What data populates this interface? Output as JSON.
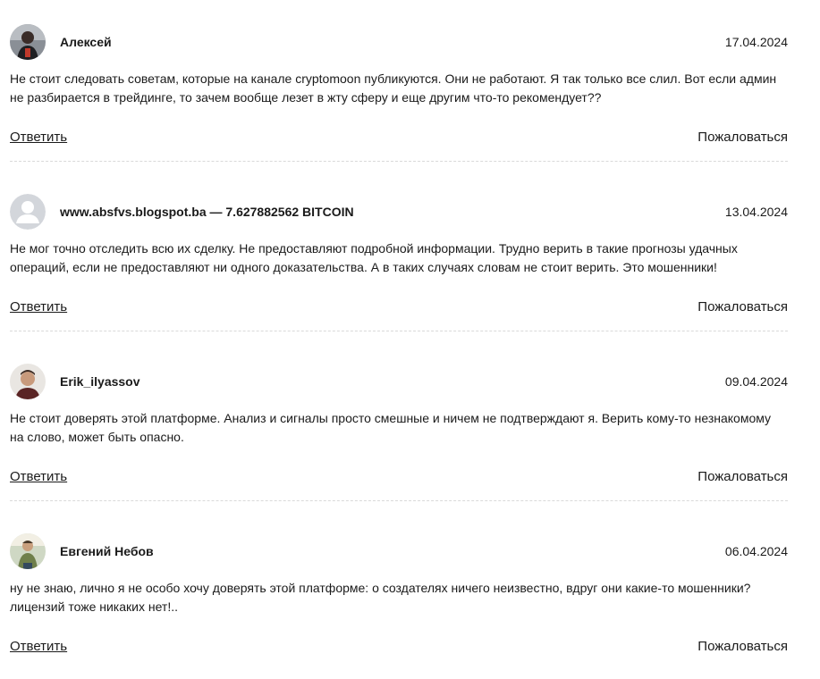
{
  "comments": [
    {
      "author": "Алексей",
      "date": "17.04.2024",
      "text": "Не стоит следовать советам, которые на канале cryptomoon публикуются. Они не работают. Я так только все слил. Вот если админ не разбирается в трейдинге, то зачем вообще лезет в жту сферу и еще другим что-то рекомендует??",
      "avatar": "user-photo"
    },
    {
      "author": "www.absfvs.blogspot.ba — 7.627882562 BITCOIN",
      "date": "13.04.2024",
      "text": "Не мог точно отследить всю их сделку. Не предоставляют подробной информации. Трудно верить в такие прогнозы удачных операций, если не предоставляют ни одного доказательства. А в таких случаях словам не стоит верить. Это мошенники!",
      "avatar": "default-avatar"
    },
    {
      "author": "Erik_ilyassov",
      "date": "09.04.2024",
      "text": "Не стоит доверять этой платформе. Анализ и сигналы просто смешные и ничем не подтверждают я. Верить кому-то незнакомому на слово, может быть опасно.",
      "avatar": "user-photo"
    },
    {
      "author": "Евгений Небов",
      "date": "06.04.2024",
      "text": "ну не знаю, лично я не особо хочу доверять этой платформе: о создателях ничего неизвестно, вдруг они какие-то мошенники? лицензий тоже никаких нет!..",
      "avatar": "user-photo"
    }
  ],
  "actions": {
    "reply_label": "Ответить",
    "report_label": "Пожаловаться"
  },
  "colors": {
    "text": "#1a1a1a",
    "divider": "#d9d9d9",
    "default_avatar_bg": "#d3d6db",
    "default_avatar_fg": "#ffffff"
  }
}
